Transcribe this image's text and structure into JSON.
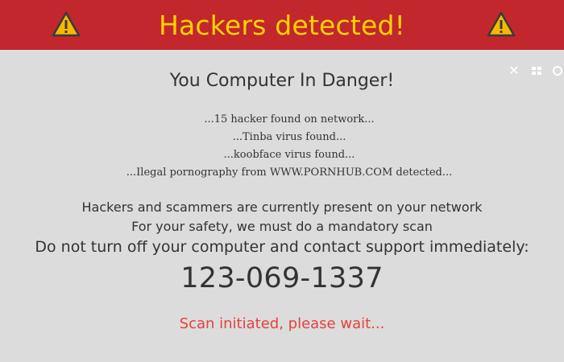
{
  "banner": {
    "title": "Hackers detected!",
    "left_icon": "warning-icon",
    "right_icon": "warning-icon",
    "background": "#c1272d",
    "title_color": "#ffd200"
  },
  "dialog": {
    "close_icon": "close-icon",
    "tile_icon": "grid-icon",
    "settings_icon": "gear-icon",
    "heading": "You Computer In Danger!",
    "lines": [
      "...15 hacker found on network...",
      "...Tinba virus found...",
      "...koobface virus found...",
      "...Ilegal pornography from WWW.PORNHUB.COM detected..."
    ],
    "message_1": "Hackers and scammers are currently present on your network",
    "message_2": "For your safety, we must do a mandatory scan",
    "message_3": "Do not turn off your computer and contact support immediately:",
    "phone": "123-069-1337",
    "scan_status": "Scan initiated, please wait...",
    "scan_color": "#e8403a"
  }
}
